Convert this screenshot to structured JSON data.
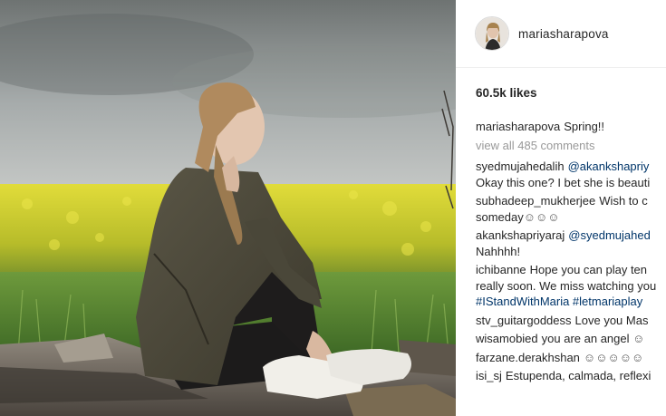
{
  "post": {
    "username": "mariasharapova",
    "likes": "60.5k likes",
    "caption": {
      "user": "mariasharapova",
      "text": "Spring!!"
    },
    "view_all": "view all 485 comments"
  },
  "comments": [
    {
      "user": "syedmujahedalih",
      "mention": "@akankshapriy",
      "text": "Okay this one? I bet she is beauti"
    },
    {
      "user": "subhadeep_mukherjee",
      "text": "Wish to c",
      "text2": "someday",
      "emoji": "☺☺☺"
    },
    {
      "user": "akankshapriyaraj",
      "mention": "@syedmujahed",
      "text": "Nahhhh!"
    },
    {
      "user": "ichibanne",
      "text": "Hope you can play ten",
      "text2": "really soon. We miss watching you",
      "tags": "#IStandWithMaria #letmariaplay"
    },
    {
      "user": "stv_guitargoddess",
      "text": "Love you Mas"
    },
    {
      "user": "wisamobied",
      "text": "you are an angel",
      "emoji": "☺"
    },
    {
      "user": "farzane.derakhshan",
      "emoji": "☺☺☺☺☺"
    },
    {
      "user": "isi_sj",
      "text": "Estupenda, calmada, reflexi"
    }
  ],
  "icons": {
    "avatar": "profile-avatar",
    "photo": "post-photo"
  }
}
